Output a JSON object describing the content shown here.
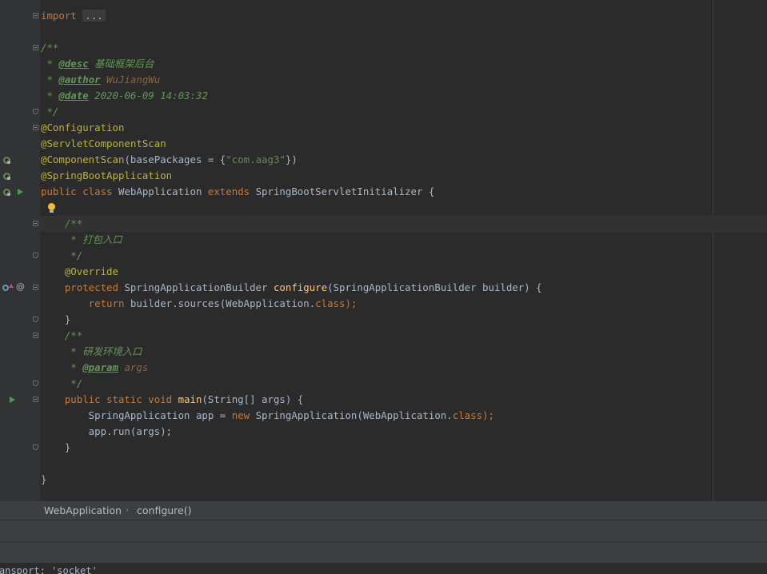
{
  "code": {
    "import_kw": "import",
    "import_folded": "...",
    "doc_open": "/**",
    "desc_prefix": " * ",
    "desc_tag": "@desc",
    "desc_value": " 基础框架后台",
    "author_prefix": " * ",
    "author_tag": "@author",
    "author_value": " WuJiangWu",
    "date_prefix": " * ",
    "date_tag": "@date",
    "date_value": " 2020-06-09 14:03:32",
    "doc_close": " */",
    "ann_configuration": "@Configuration",
    "ann_servlet_scan": "@ServletComponentScan",
    "ann_component_scan": "@ComponentScan",
    "component_scan_args_open": "(basePackages = {",
    "component_scan_pkg": "\"com.aag3\"",
    "component_scan_args_close": "})",
    "ann_springboot": "@SpringBootApplication",
    "class_kw": "public class ",
    "class_name": "WebApplication ",
    "extends_kw": "extends ",
    "super_class": "SpringBootServletInitializer {",
    "doc2_open": "    /**",
    "doc2_line": "     * 打包入口",
    "doc2_close": "     */",
    "ann_override": "    @Override",
    "protected_kw": "    protected ",
    "builder_type": "SpringApplicationBuilder ",
    "configure_fn": "configure",
    "configure_params": "(SpringApplicationBuilder builder) {",
    "return_kw": "        return ",
    "return_expr": "builder.sources(WebApplication.",
    "class_ref": "class",
    "return_end": ");",
    "close_method1": "    }",
    "doc3_open": "    /**",
    "doc3_line": "     * 研发环境入口",
    "doc3_param_prefix": "     * ",
    "doc3_param_tag": "@param",
    "doc3_param_value": " args",
    "doc3_close": "     */",
    "main_kw": "    public static void ",
    "main_fn": "main",
    "main_params": "(String[] args) {",
    "app_decl": "        SpringApplication app = ",
    "new_kw": "new ",
    "app_ctor": "SpringApplication(WebApplication.",
    "app_ctor_class": "class",
    "app_ctor_end": ");",
    "app_run": "        app.run(args);",
    "close_method2": "    }",
    "close_class": "}"
  },
  "breadcrumbs": {
    "class": "WebApplication",
    "separator": "›",
    "method": "configure()"
  },
  "console": {
    "text": "ansport: 'socket'"
  },
  "colors": {
    "background": "#2b2b2b",
    "keyword": "#cc7832",
    "annotation": "#bbb529",
    "string": "#6a8759",
    "comment": "#629755",
    "function": "#ffc66d"
  }
}
